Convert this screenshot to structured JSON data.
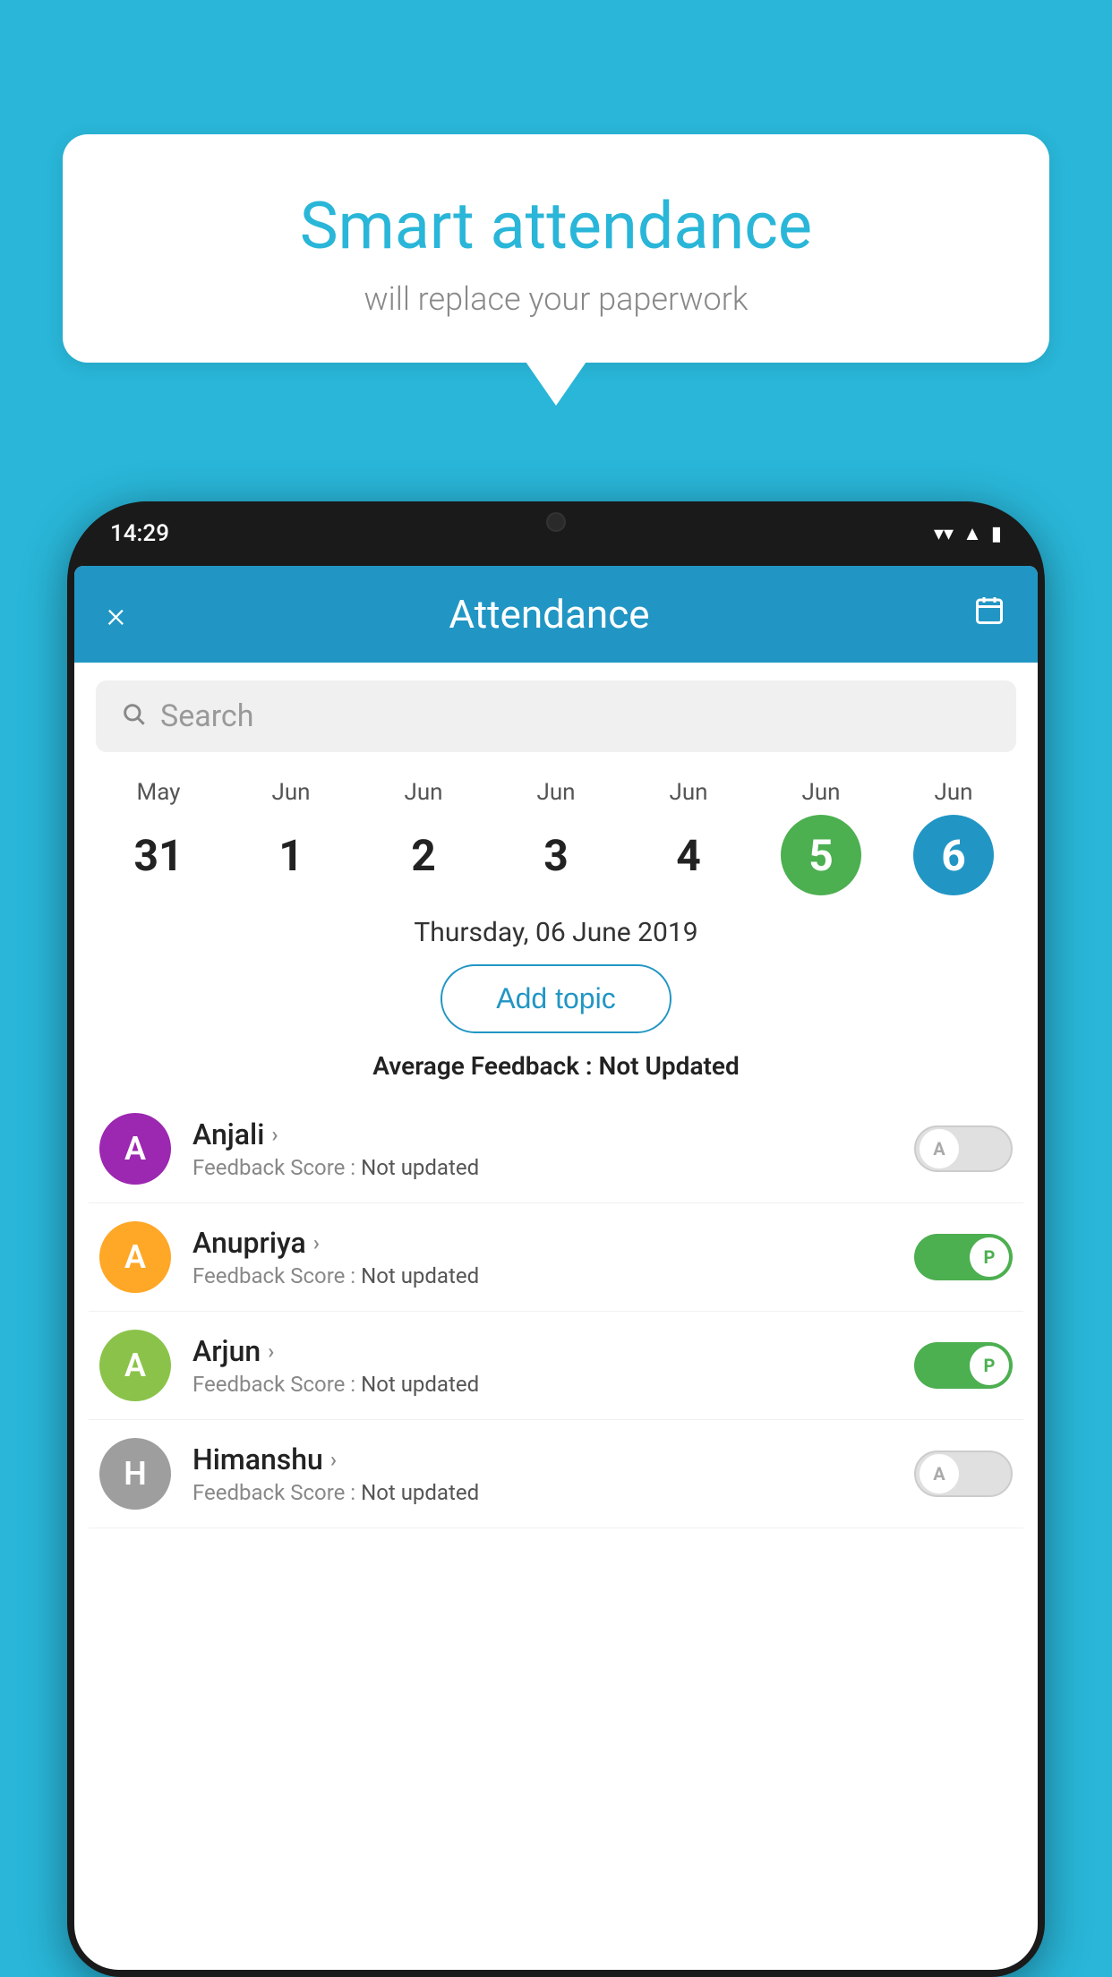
{
  "background_color": "#29b6d8",
  "speech_bubble": {
    "title": "Smart attendance",
    "subtitle": "will replace your paperwork"
  },
  "status_bar": {
    "time": "14:29",
    "icons": [
      "▲",
      "▲",
      "▮"
    ]
  },
  "app_header": {
    "title": "Attendance",
    "close_label": "×",
    "calendar_label": "📅"
  },
  "search": {
    "placeholder": "Search"
  },
  "calendar": {
    "days": [
      {
        "month": "May",
        "date": "31",
        "state": "normal"
      },
      {
        "month": "Jun",
        "date": "1",
        "state": "normal"
      },
      {
        "month": "Jun",
        "date": "2",
        "state": "normal"
      },
      {
        "month": "Jun",
        "date": "3",
        "state": "normal"
      },
      {
        "month": "Jun",
        "date": "4",
        "state": "normal"
      },
      {
        "month": "Jun",
        "date": "5",
        "state": "green"
      },
      {
        "month": "Jun",
        "date": "6",
        "state": "blue"
      }
    ],
    "selected_date_label": "Thursday, 06 June 2019"
  },
  "add_topic_label": "Add topic",
  "avg_feedback_label": "Average Feedback :",
  "avg_feedback_value": "Not Updated",
  "students": [
    {
      "name": "Anjali",
      "avatar_letter": "A",
      "avatar_color": "#9c27b0",
      "feedback_label": "Feedback Score :",
      "feedback_value": "Not updated",
      "attendance": "absent"
    },
    {
      "name": "Anupriya",
      "avatar_letter": "A",
      "avatar_color": "#ffa726",
      "feedback_label": "Feedback Score :",
      "feedback_value": "Not updated",
      "attendance": "present"
    },
    {
      "name": "Arjun",
      "avatar_letter": "A",
      "avatar_color": "#8bc34a",
      "feedback_label": "Feedback Score :",
      "feedback_value": "Not updated",
      "attendance": "present"
    },
    {
      "name": "Himanshu",
      "avatar_letter": "H",
      "avatar_color": "#9e9e9e",
      "feedback_label": "Feedback Score :",
      "feedback_value": "Not updated",
      "attendance": "absent"
    }
  ]
}
